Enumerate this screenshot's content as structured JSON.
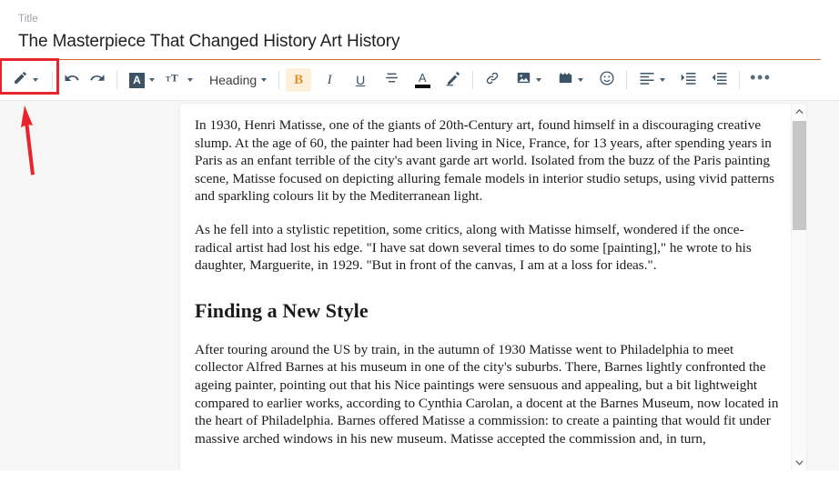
{
  "title_field": {
    "label": "Title",
    "value": "The Masterpiece That Changed History Art History",
    "placeholder": "Title",
    "underline_color": "#d2653a"
  },
  "toolbar": {
    "pencil_label": "",
    "undo_label": "",
    "redo_label": "",
    "font_color_letter": "A",
    "text_size_label": "T",
    "heading_label": "Heading",
    "bold_label": "B",
    "italic_label": "I",
    "underline_label": "U",
    "strikethrough_label": "",
    "text_color_letter": "A",
    "highlight_label": "",
    "link_label": "",
    "image_label": "",
    "video_label": "",
    "emoji_label": "",
    "align_label": "",
    "indent_label": "",
    "outdent_label": "",
    "more_label": "•••",
    "active_button": "bold",
    "highlighted_button": "pencil",
    "accent_active_color": "#e8912a",
    "icon_color": "#3c5366"
  },
  "annotation": {
    "box_color": "#e8242c",
    "arrow_color": "#e8242c",
    "target": "pencil-dropdown-button"
  },
  "document": {
    "paragraphs": [
      "In 1930, Henri Matisse, one of the giants of 20th-Century art, found himself in a discouraging creative slump. At the age of 60, the painter had been living in Nice, France, for 13 years, after spending years in Paris as an enfant terrible of the city's avant garde art world. Isolated from the buzz of the Paris painting scene, Matisse focused on depicting alluring female models in interior studio setups, using vivid patterns and sparkling colours lit by the Mediterranean light.",
      "As he fell into a stylistic repetition, some critics, along with Matisse himself, wondered if the once-radical artist had lost his edge. \"I have sat down several times to do some [painting],\" he wrote to his daughter, Marguerite, in 1929. \"But in front of the canvas, I am at a loss for ideas.\"."
    ],
    "heading": "Finding a New Style",
    "paragraph_after_heading": "After touring around the US by train, in the autumn of 1930 Matisse went to Philadelphia to meet collector Alfred Barnes at his museum in one of the city's suburbs. There, Barnes lightly confronted the ageing painter, pointing out that his Nice paintings were sensuous and appealing, but a bit lightweight compared to earlier works, according to Cynthia Carolan, a docent at the Barnes Museum, now located in the heart of Philadelphia. Barnes offered Matisse a commission: to create a painting that would fit under massive arched windows in his new museum. Matisse accepted the commission and, in turn,"
  },
  "scrollbar": {
    "up_arrow": "⌃",
    "down_arrow": "⌄",
    "thumb_position_percent": 0
  }
}
